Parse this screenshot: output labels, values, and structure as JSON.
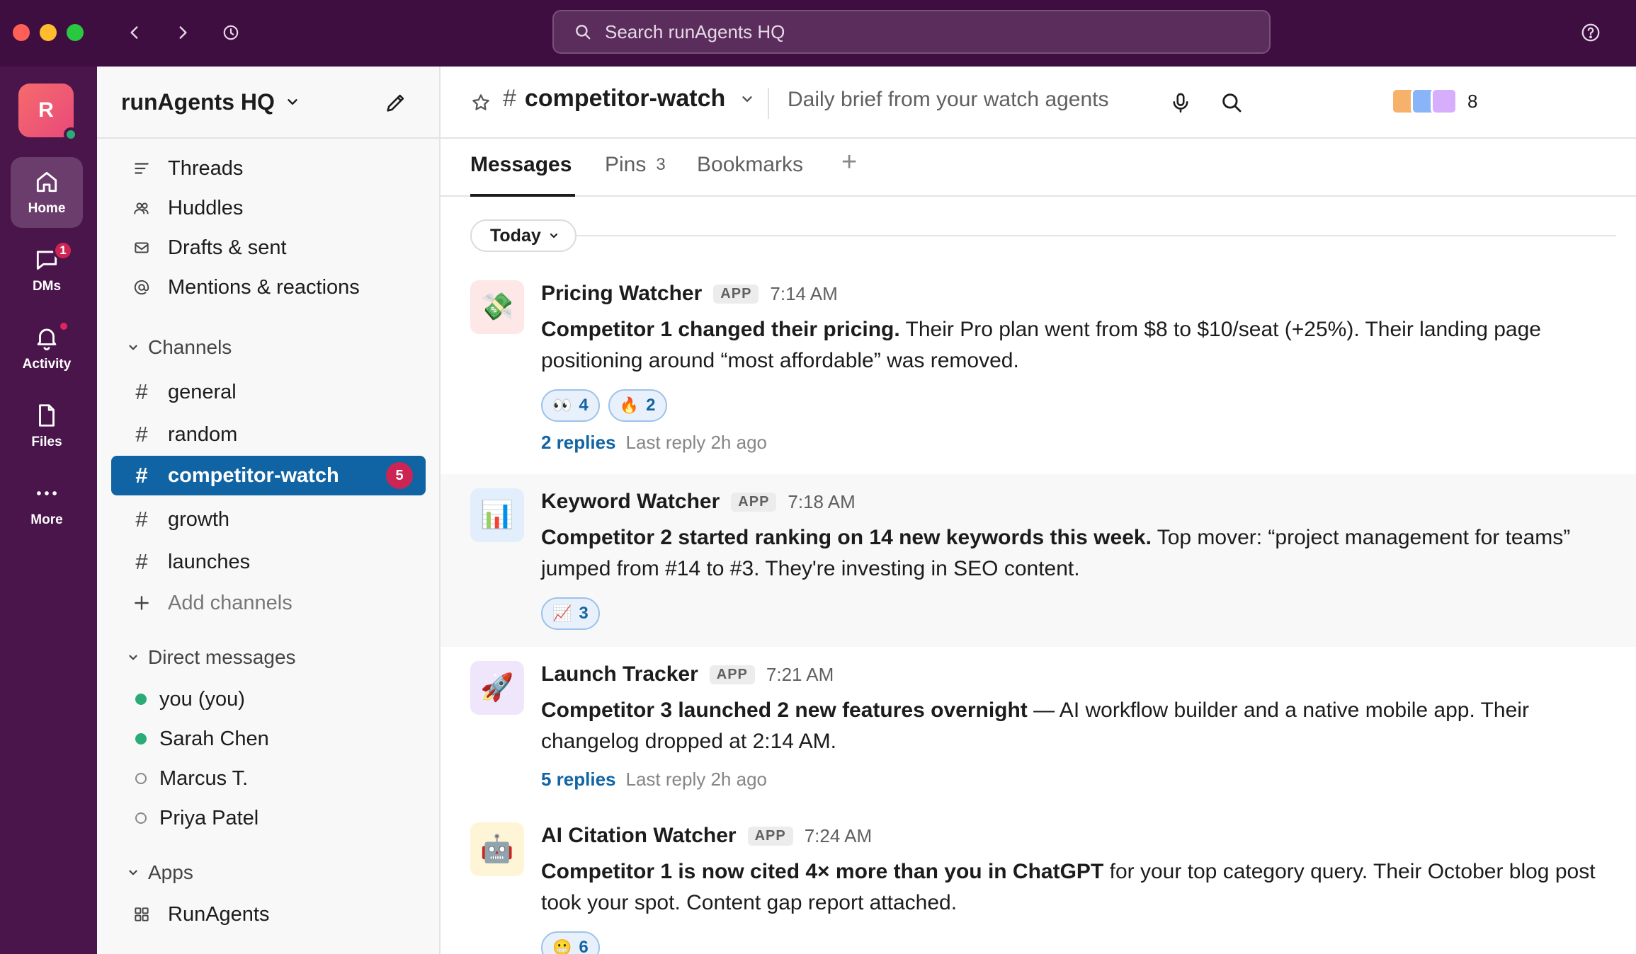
{
  "search": {
    "placeholder": "Search runAgents HQ"
  },
  "rail": {
    "workspace_initial": "R",
    "items": [
      {
        "label": "Home"
      },
      {
        "label": "DMs",
        "badge": "1"
      },
      {
        "label": "Activity"
      },
      {
        "label": "Files"
      },
      {
        "label": "More"
      }
    ]
  },
  "sidebar": {
    "workspace_name": "runAgents HQ",
    "nav": [
      {
        "label": "Threads"
      },
      {
        "label": "Huddles"
      },
      {
        "label": "Drafts & sent"
      },
      {
        "label": "Mentions & reactions"
      }
    ],
    "channels_section": "Channels",
    "channels": [
      {
        "name": "general"
      },
      {
        "name": "random"
      },
      {
        "name": "competitor-watch",
        "badge": "5"
      },
      {
        "name": "growth"
      },
      {
        "name": "launches"
      }
    ],
    "add_channels": "Add channels",
    "dm_section": "Direct messages",
    "dms": [
      {
        "name": "you (you)",
        "online": true
      },
      {
        "name": "Sarah Chen",
        "online": true
      },
      {
        "name": "Marcus T.",
        "online": false
      },
      {
        "name": "Priya Patel",
        "online": false
      }
    ],
    "apps_section": "Apps",
    "apps": [
      {
        "name": "RunAgents"
      }
    ]
  },
  "channel": {
    "hash": "#",
    "name": "competitor-watch",
    "topic": "Daily brief from your watch agents",
    "member_count": "8",
    "member_colors": [
      "#f6b26b",
      "#8ab4f8",
      "#d7aefb"
    ]
  },
  "tabs": {
    "messages": "Messages",
    "pins": "Pins",
    "pins_count": "3",
    "bookmarks": "Bookmarks",
    "add": "+"
  },
  "date_divider": "Today",
  "messages": [
    {
      "sender": "Pricing Watcher",
      "tag": "APP",
      "time": "7:14 AM",
      "avatar_emoji": "💸",
      "avatar_bg": "#fde7e7",
      "bold": "Competitor 1 changed their pricing.",
      "text": " Their Pro plan went from $8 to $10/seat (+25%). Their landing page positioning around “most affordable” was removed.",
      "reactions": [
        {
          "emoji": "👀",
          "count": "4"
        },
        {
          "emoji": "🔥",
          "count": "2"
        }
      ],
      "replies": "2 replies",
      "last_reply": "Last reply 2h ago"
    },
    {
      "sender": "Keyword Watcher",
      "tag": "APP",
      "time": "7:18 AM",
      "avatar_emoji": "📊",
      "avatar_bg": "#e3eefc",
      "bold": "Competitor 2 started ranking on 14 new keywords this week.",
      "text": " Top mover: “project management for teams” jumped from #14 to #3. They're investing in SEO content.",
      "reactions": [
        {
          "emoji": "📈",
          "count": "3"
        }
      ]
    },
    {
      "sender": "Launch Tracker",
      "tag": "APP",
      "time": "7:21 AM",
      "avatar_emoji": "🚀",
      "avatar_bg": "#efe6fb",
      "bold": "Competitor 3 launched 2 new features overnight",
      "text": " — AI workflow builder and a native mobile app. Their changelog dropped at 2:14 AM.",
      "replies": "5 replies",
      "last_reply": "Last reply 2h ago"
    },
    {
      "sender": "AI Citation Watcher",
      "tag": "APP",
      "time": "7:24 AM",
      "avatar_emoji": "🤖",
      "avatar_bg": "#fdf5d6",
      "bold": "Competitor 1 is now cited 4× more than you in ChatGPT",
      "text": " for your top category query. Their October blog post took your spot. Content gap report attached.",
      "reactions": [
        {
          "emoji": "😬",
          "count": "6"
        }
      ]
    }
  ]
}
